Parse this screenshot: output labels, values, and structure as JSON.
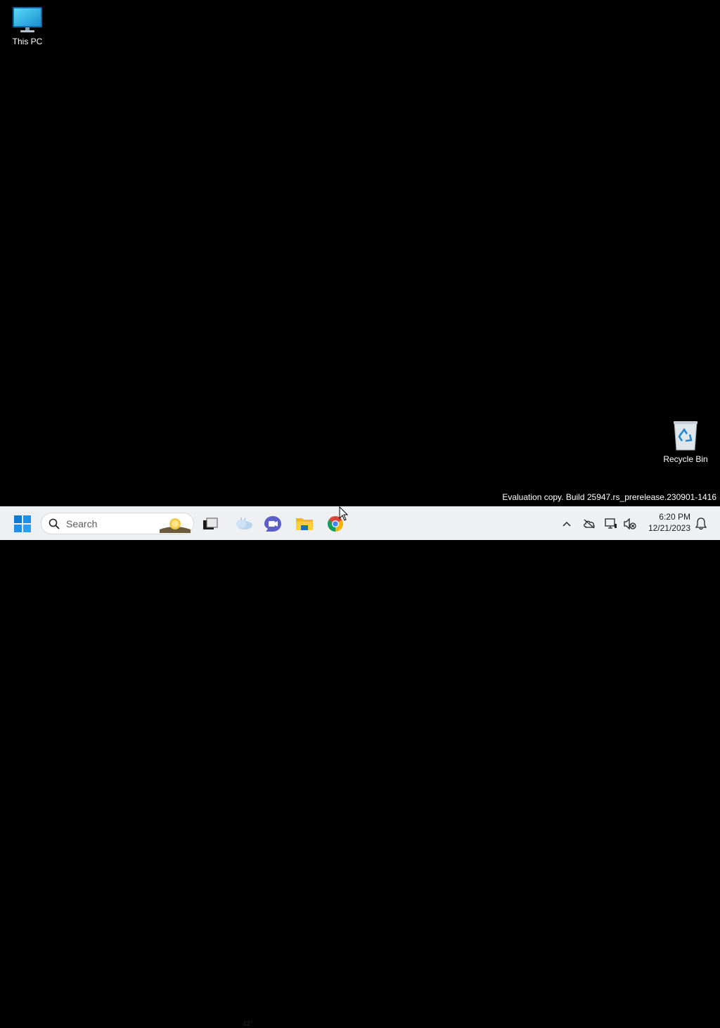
{
  "desktop": {
    "icons": [
      {
        "label": "This PC",
        "icon": "monitor-icon"
      },
      {
        "label": "Recycle Bin",
        "icon": "recycle-bin-icon"
      }
    ],
    "watermark": "Evaluation copy. Build 25947.rs_prerelease.230901-1416"
  },
  "taskbar": {
    "start_icon": "windows-logo-icon",
    "search": {
      "placeholder": "Search",
      "icon": "search-icon"
    },
    "apps": [
      {
        "name": "Task View",
        "icon": "task-view-icon"
      },
      {
        "name": "Weather",
        "icon": "weather-icon"
      },
      {
        "name": "Chat",
        "icon": "chat-icon"
      },
      {
        "name": "File Explorer",
        "icon": "folder-icon"
      },
      {
        "name": "Google Chrome",
        "icon": "chrome-icon"
      }
    ],
    "weather_temp": "42°",
    "tray": {
      "icons": [
        "chevron-up-icon",
        "onedrive-offline-icon",
        "network-icon",
        "volume-muted-icon",
        "notification-bell-icon"
      ],
      "time": "6:20 PM",
      "date": "12/21/2023"
    }
  },
  "colors": {
    "desktop_bg": "#000000",
    "taskbar_bg": "#eef0f3",
    "windows_blue": "#0a7bd8"
  }
}
